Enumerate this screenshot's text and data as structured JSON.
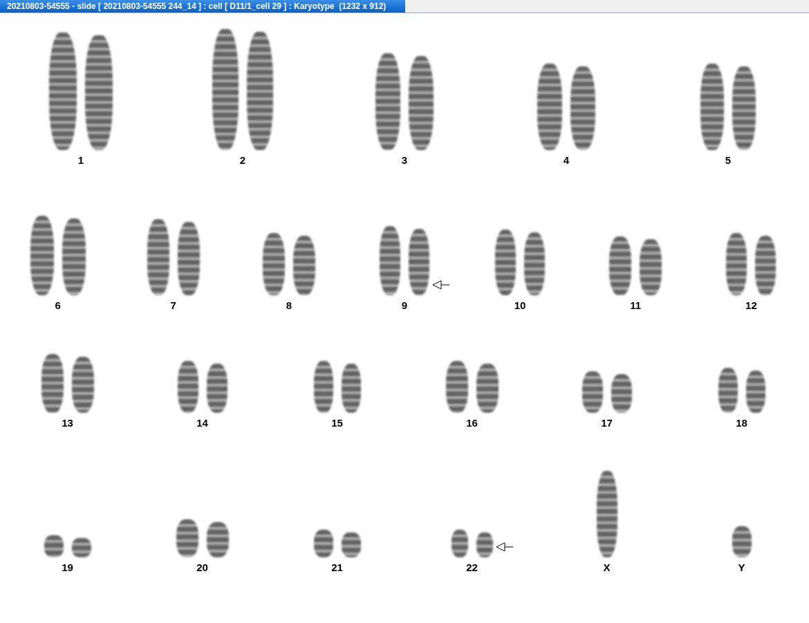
{
  "window": {
    "title": "20210803-54555 - slide [ 20210803-54555 244_14 ] : cell [ D11/1_cell 29 ] : Karyotype  (1232 x 912)"
  },
  "rows": [
    {
      "chromosomes": [
        {
          "label": "1",
          "kind": "pair",
          "marked": false
        },
        {
          "label": "2",
          "kind": "pair",
          "marked": false
        },
        {
          "label": "3",
          "kind": "pair",
          "marked": false
        },
        {
          "label": "4",
          "kind": "pair",
          "marked": false
        },
        {
          "label": "5",
          "kind": "pair",
          "marked": false
        }
      ]
    },
    {
      "chromosomes": [
        {
          "label": "6",
          "kind": "pair",
          "marked": false
        },
        {
          "label": "7",
          "kind": "pair",
          "marked": false
        },
        {
          "label": "8",
          "kind": "pair",
          "marked": false
        },
        {
          "label": "9",
          "kind": "pair",
          "marked": true
        },
        {
          "label": "10",
          "kind": "pair",
          "marked": false
        },
        {
          "label": "11",
          "kind": "pair",
          "marked": false
        },
        {
          "label": "12",
          "kind": "pair",
          "marked": false
        }
      ]
    },
    {
      "chromosomes": [
        {
          "label": "13",
          "kind": "pair",
          "marked": false
        },
        {
          "label": "14",
          "kind": "pair",
          "marked": false
        },
        {
          "label": "15",
          "kind": "pair",
          "marked": false
        },
        {
          "label": "16",
          "kind": "pair",
          "marked": false
        },
        {
          "label": "17",
          "kind": "pair",
          "marked": false
        },
        {
          "label": "18",
          "kind": "pair",
          "marked": false
        }
      ]
    },
    {
      "chromosomes": [
        {
          "label": "19",
          "kind": "pair",
          "marked": false
        },
        {
          "label": "20",
          "kind": "pair",
          "marked": false
        },
        {
          "label": "21",
          "kind": "pair",
          "marked": false
        },
        {
          "label": "22",
          "kind": "pair",
          "marked": true
        },
        {
          "label": "X",
          "kind": "single",
          "marked": false
        },
        {
          "label": "Y",
          "kind": "single",
          "marked": false
        }
      ]
    }
  ]
}
